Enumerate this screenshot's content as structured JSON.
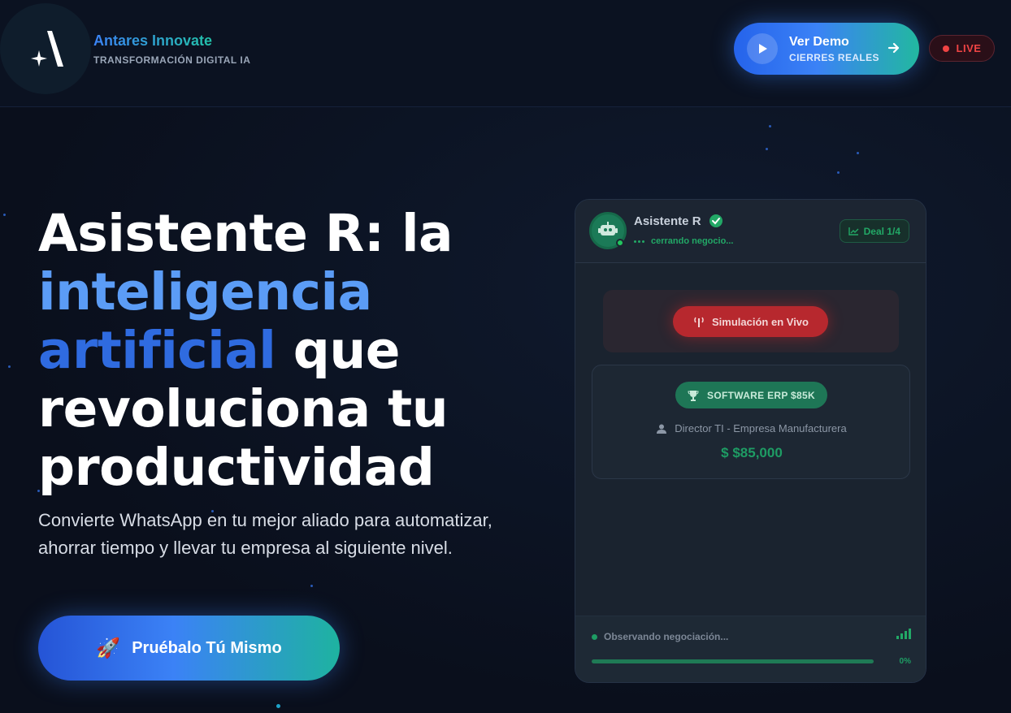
{
  "header": {
    "brand_name": "Antares Innovate",
    "brand_tagline": "TRANSFORMACIÓN DIGITAL IA",
    "demo_button": {
      "title": "Ver Demo",
      "subtitle": "CIERRES REALES"
    },
    "live_badge": "LIVE"
  },
  "hero": {
    "title_line1": "Asistente R: la",
    "title_highlight1": "inteligencia",
    "title_highlight2": "artificial",
    "title_after_highlight": " que",
    "title_line4": "revoluciona tu",
    "title_line5": "productividad",
    "subtitle": "Convierte WhatsApp en tu mejor aliado para automatizar, ahorrar tiempo y llevar tu empresa al siguiente nivel.",
    "cta_label": "Pruébalo Tú Mismo",
    "cta_emoji": "🚀"
  },
  "card": {
    "assistant_name": "Asistente R",
    "status_text": "cerrando negocio...",
    "deal_badge": "Deal 1/4",
    "simulation_button": "Simulación en Vivo",
    "product_badge": "SOFTWARE ERP $85K",
    "contact": "Director TI - Empresa Manufacturera",
    "amount": "$  $85,000",
    "footer_status": "Observando negociación...",
    "progress_label": "0%",
    "progress_value": 0
  },
  "colors": {
    "accent_blue": "#3b82f6",
    "accent_teal": "#22c1a8",
    "live_red": "#ef4444",
    "success_green": "#1e9c64"
  },
  "icons": [
    "logo-mark-icon",
    "play-icon",
    "arrow-right-icon",
    "robot-icon",
    "verified-check-icon",
    "trend-chart-icon",
    "broadcast-icon",
    "trophy-icon",
    "user-icon",
    "signal-bars-icon",
    "rocket-icon"
  ]
}
